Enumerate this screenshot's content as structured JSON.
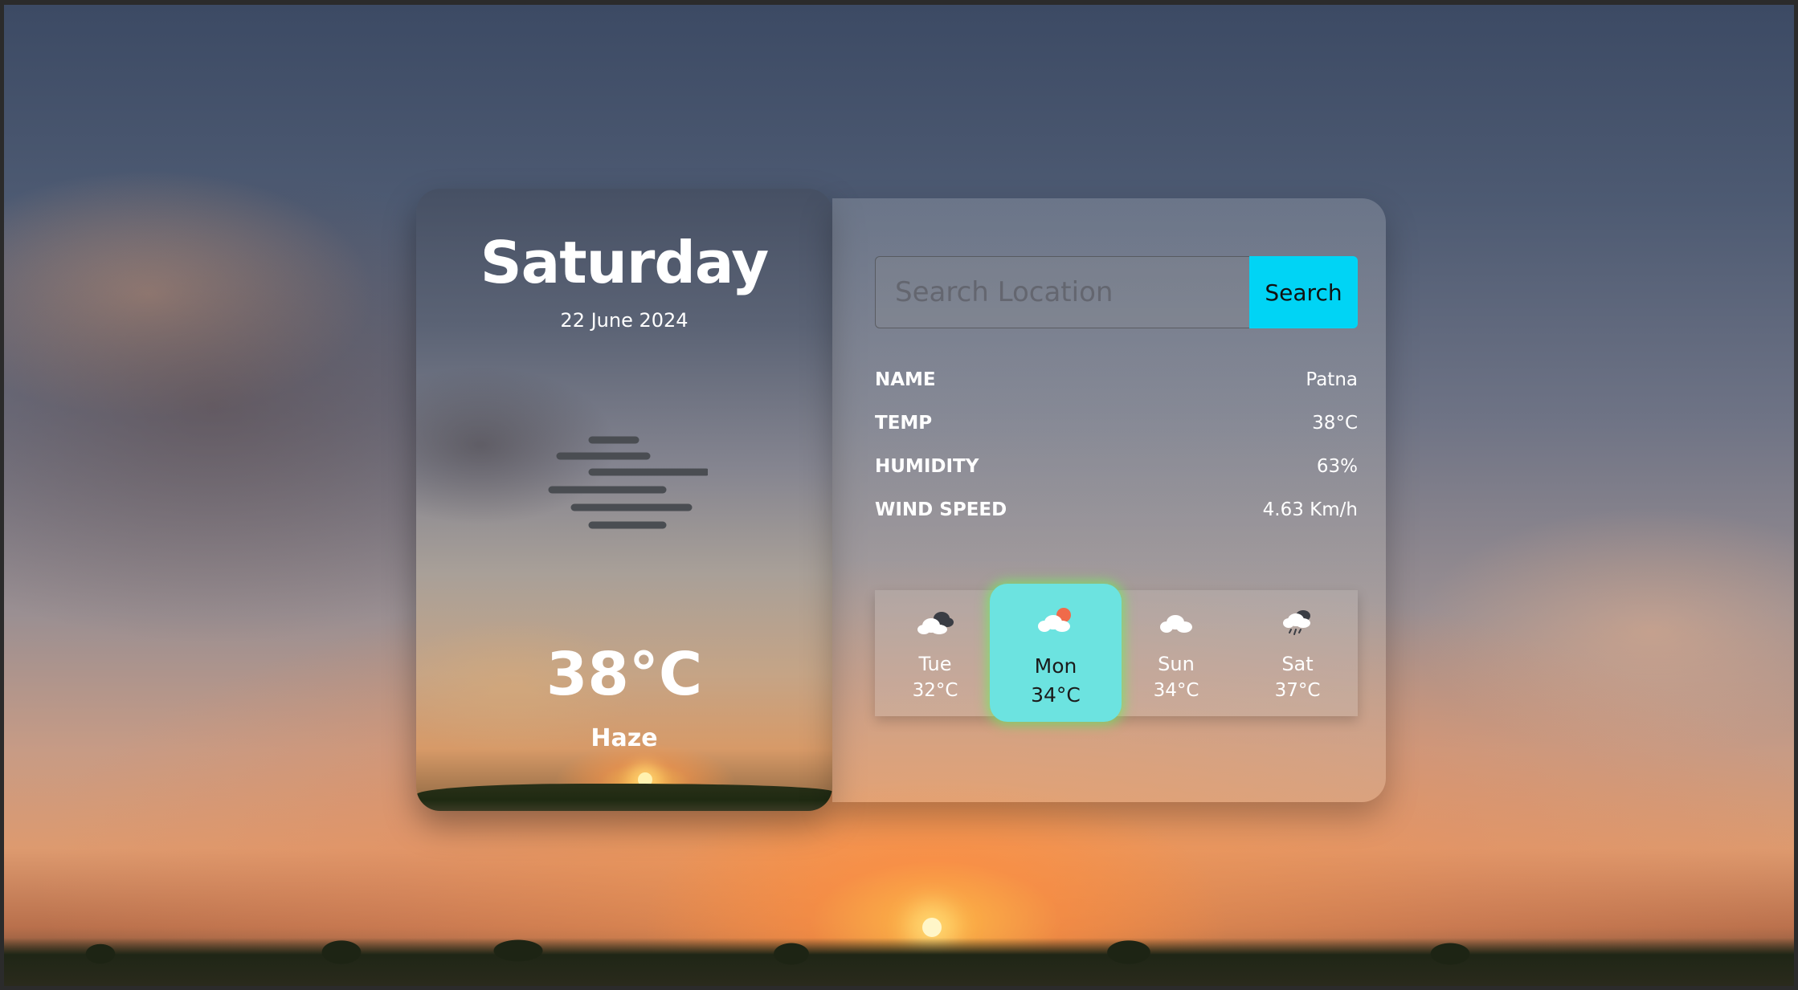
{
  "app": {
    "day": "Saturday",
    "date": "22 June 2024",
    "temperature": "38°C",
    "condition": "Haze",
    "condition_icon": "haze-icon"
  },
  "search": {
    "placeholder": "Search Location",
    "value": "",
    "button_label": "Search"
  },
  "details": [
    {
      "label": "NAME",
      "value": "Patna"
    },
    {
      "label": "TEMP",
      "value": "38°C"
    },
    {
      "label": "HUMIDITY",
      "value": "63%"
    },
    {
      "label": "WIND SPEED",
      "value": "4.63 Km/h"
    }
  ],
  "forecast": [
    {
      "day": "Tue",
      "temp": "32°C",
      "icon": "cloudy-icon",
      "active": false
    },
    {
      "day": "Mon",
      "temp": "34°C",
      "icon": "partly-cloudy-icon",
      "active": true
    },
    {
      "day": "Sun",
      "temp": "34°C",
      "icon": "cloud-icon",
      "active": false
    },
    {
      "day": "Sat",
      "temp": "37°C",
      "icon": "rain-cloud-icon",
      "active": false
    }
  ],
  "colors": {
    "accent": "#00d4f5",
    "active_day": "#6ce3e0",
    "active_glow": "#78e664"
  }
}
